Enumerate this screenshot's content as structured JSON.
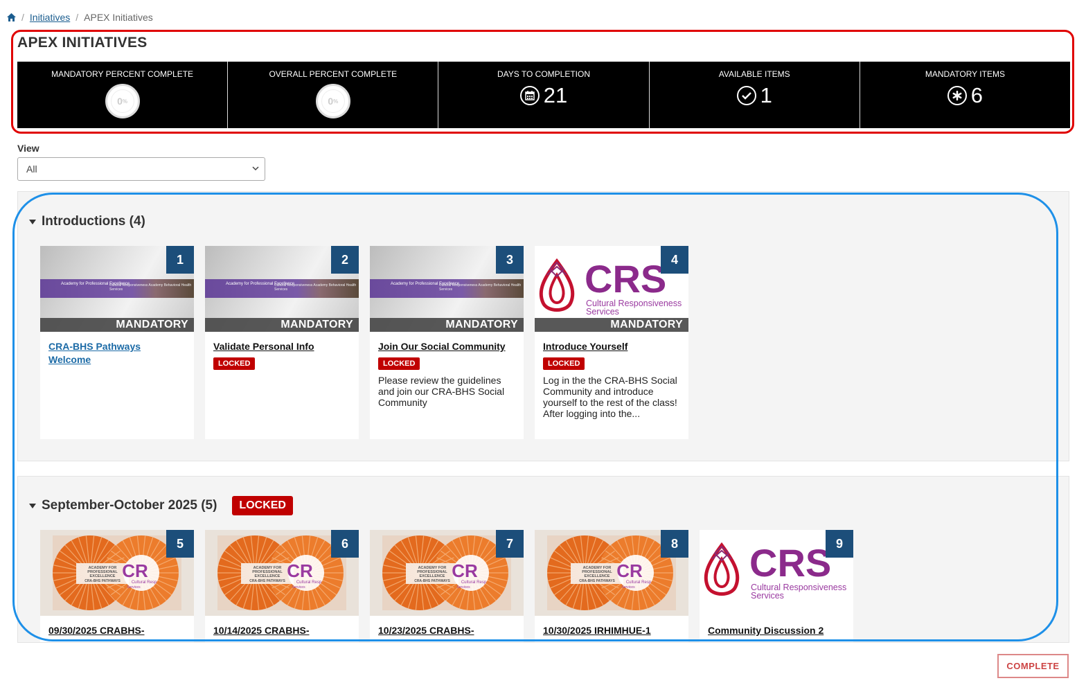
{
  "breadcrumb": {
    "home_icon": "home-icon",
    "items": [
      "Initiatives",
      "APEX Initiatives"
    ]
  },
  "title": "APEX INITIATIVES",
  "stats": [
    {
      "label": "MANDATORY PERCENT COMPLETE",
      "value": "0",
      "unit": "%",
      "type": "ring"
    },
    {
      "label": "OVERALL PERCENT COMPLETE",
      "value": "0",
      "unit": "%",
      "type": "ring"
    },
    {
      "label": "DAYS TO COMPLETION",
      "value": "21",
      "icon": "calendar-icon"
    },
    {
      "label": "AVAILABLE ITEMS",
      "value": "1",
      "icon": "check-icon"
    },
    {
      "label": "MANDATORY ITEMS",
      "value": "6",
      "icon": "asterisk-icon"
    }
  ],
  "view": {
    "label": "View",
    "selected": "All"
  },
  "sections": [
    {
      "title": "Introductions (4)",
      "cards": [
        {
          "num": "1",
          "tag": "MANDATORY",
          "title": "CRA-BHS Pathways Welcome",
          "thumb": "apex-banner",
          "banner_a": "Academy for Professional Excellence",
          "banner_b": "Cultural Responsiveness Academy Behavioral Health Services"
        },
        {
          "num": "2",
          "tag": "MANDATORY",
          "title": "Validate Personal Info",
          "status": "LOCKED",
          "thumb": "apex-banner",
          "banner_a": "Academy for Professional Excellence",
          "banner_b": "Cultural Responsiveness Academy Behavioral Health Services"
        },
        {
          "num": "3",
          "tag": "MANDATORY",
          "title": "Join Our Social Community",
          "status": "LOCKED",
          "desc": "Please review the guidelines and join our CRA-BHS Social Community",
          "thumb": "apex-banner",
          "banner_a": "Academy for Professional Excellence",
          "banner_b": "Cultural Responsiveness Academy Behavioral Health Services"
        },
        {
          "num": "4",
          "tag": "MANDATORY",
          "title": "Introduce Yourself",
          "status": "LOCKED",
          "desc": "Log in the the CRA-BHS Social Community and introduce yourself to the rest of the class! After logging into the...",
          "thumb": "crs-logo",
          "logo_big": "CRS",
          "logo_small": "Cultural Responsiveness",
          "logo_small2": "Services"
        }
      ]
    },
    {
      "title": "September-October 2025 (5)",
      "status": "LOCKED",
      "cards": [
        {
          "num": "5",
          "title": "09/30/2025 CRABHS-",
          "thumb": "orange"
        },
        {
          "num": "6",
          "title": "10/14/2025 CRABHS-",
          "thumb": "orange"
        },
        {
          "num": "7",
          "title": "10/23/2025 CRABHS-",
          "thumb": "orange"
        },
        {
          "num": "8",
          "title": "10/30/2025 IRHIMHUE-1",
          "thumb": "orange"
        },
        {
          "num": "9",
          "title": "Community Discussion 2",
          "thumb": "crs-logo",
          "logo_big": "CRS",
          "logo_small": "Cultural Responsiveness",
          "logo_small2": "Services"
        }
      ]
    }
  ],
  "orange_logo": {
    "line1": "ACADEMY FOR",
    "line2": "PROFESSIONAL",
    "line3": "EXCELLENCE",
    "line4": "CRA-BHS PATHWAYS",
    "cr": "CR",
    "cr_sub": "Cultural Resp",
    "cr_sub2": "Services"
  },
  "complete_button": "COMPLETE",
  "colors": {
    "highlight_red": "#e00000",
    "highlight_blue": "#1e90e8",
    "badge": "#1c4e7a",
    "locked": "#c00000"
  }
}
